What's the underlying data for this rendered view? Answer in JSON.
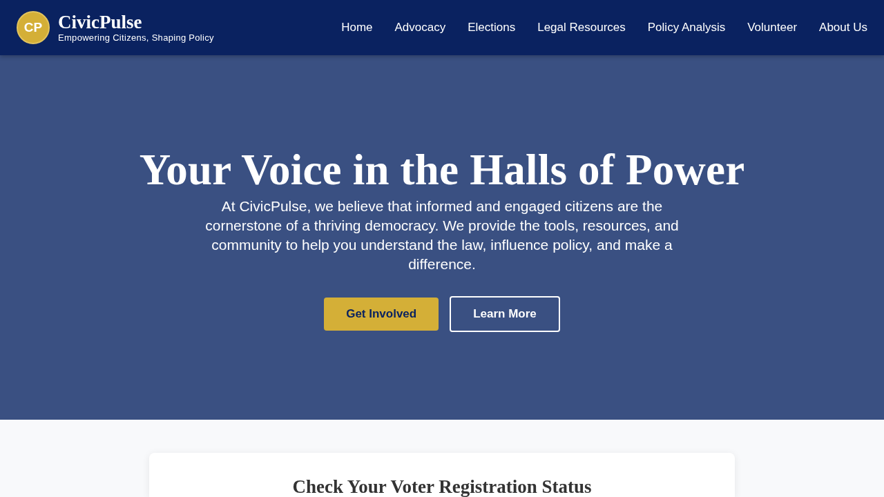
{
  "header": {
    "logo": {
      "initials": "CP",
      "name": "CivicPulse",
      "tagline": "Empowering Citizens, Shaping Policy"
    },
    "nav": [
      {
        "label": "Home"
      },
      {
        "label": "Advocacy"
      },
      {
        "label": "Elections"
      },
      {
        "label": "Legal Resources"
      },
      {
        "label": "Policy Analysis"
      },
      {
        "label": "Volunteer"
      },
      {
        "label": "About Us"
      }
    ]
  },
  "hero": {
    "title": "Your Voice in the Halls of Power",
    "text": "At CivicPulse, we believe that informed and engaged citizens are the cornerstone of a thriving democracy. We provide the tools, resources, and community to help you understand the law, influence policy, and make a difference.",
    "buttons": [
      {
        "label": "Get Involved",
        "kind": "primary"
      },
      {
        "label": "Learn More",
        "kind": "outline"
      }
    ]
  },
  "voter_check": {
    "title": "Check Your Voter Registration Status"
  }
}
